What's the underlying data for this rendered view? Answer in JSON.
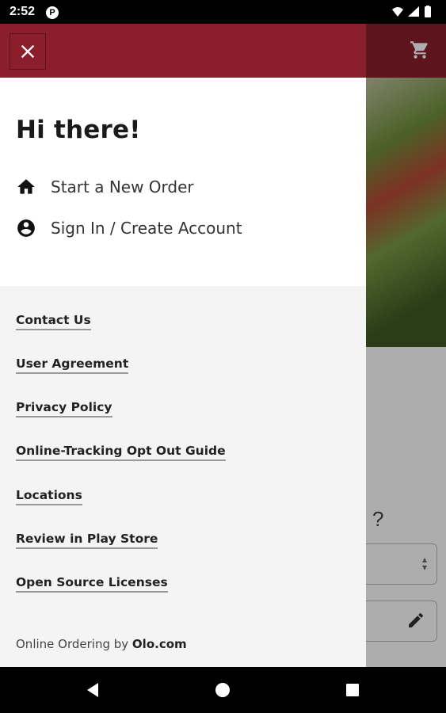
{
  "status_bar": {
    "time": "2:52",
    "app_icon": "P",
    "icons": [
      "wifi-icon",
      "signal-icon",
      "battery-icon"
    ]
  },
  "drawer": {
    "header_color": "#8a1f2b",
    "close_icon": "close-icon",
    "greeting": "Hi there!",
    "menu": [
      {
        "icon": "home-icon",
        "label": "Start a New Order"
      },
      {
        "icon": "account-circle-icon",
        "label": "Sign In / Create Account"
      }
    ],
    "links": [
      "Contact Us",
      "User Agreement",
      "Privacy Policy",
      "Online-Tracking Opt Out Guide",
      "Locations",
      "Review in Play Store",
      "Open Source Licenses"
    ],
    "footer_prefix": "Online Ordering by ",
    "footer_brand": "Olo.com"
  },
  "background": {
    "cart_icon": "cart-icon",
    "question_fragment": "?",
    "select_icon": "unfold-icon",
    "edit_icon": "pencil-icon"
  },
  "nav_bar": {
    "icons": [
      "back-icon",
      "home-circle-icon",
      "recents-icon"
    ]
  }
}
